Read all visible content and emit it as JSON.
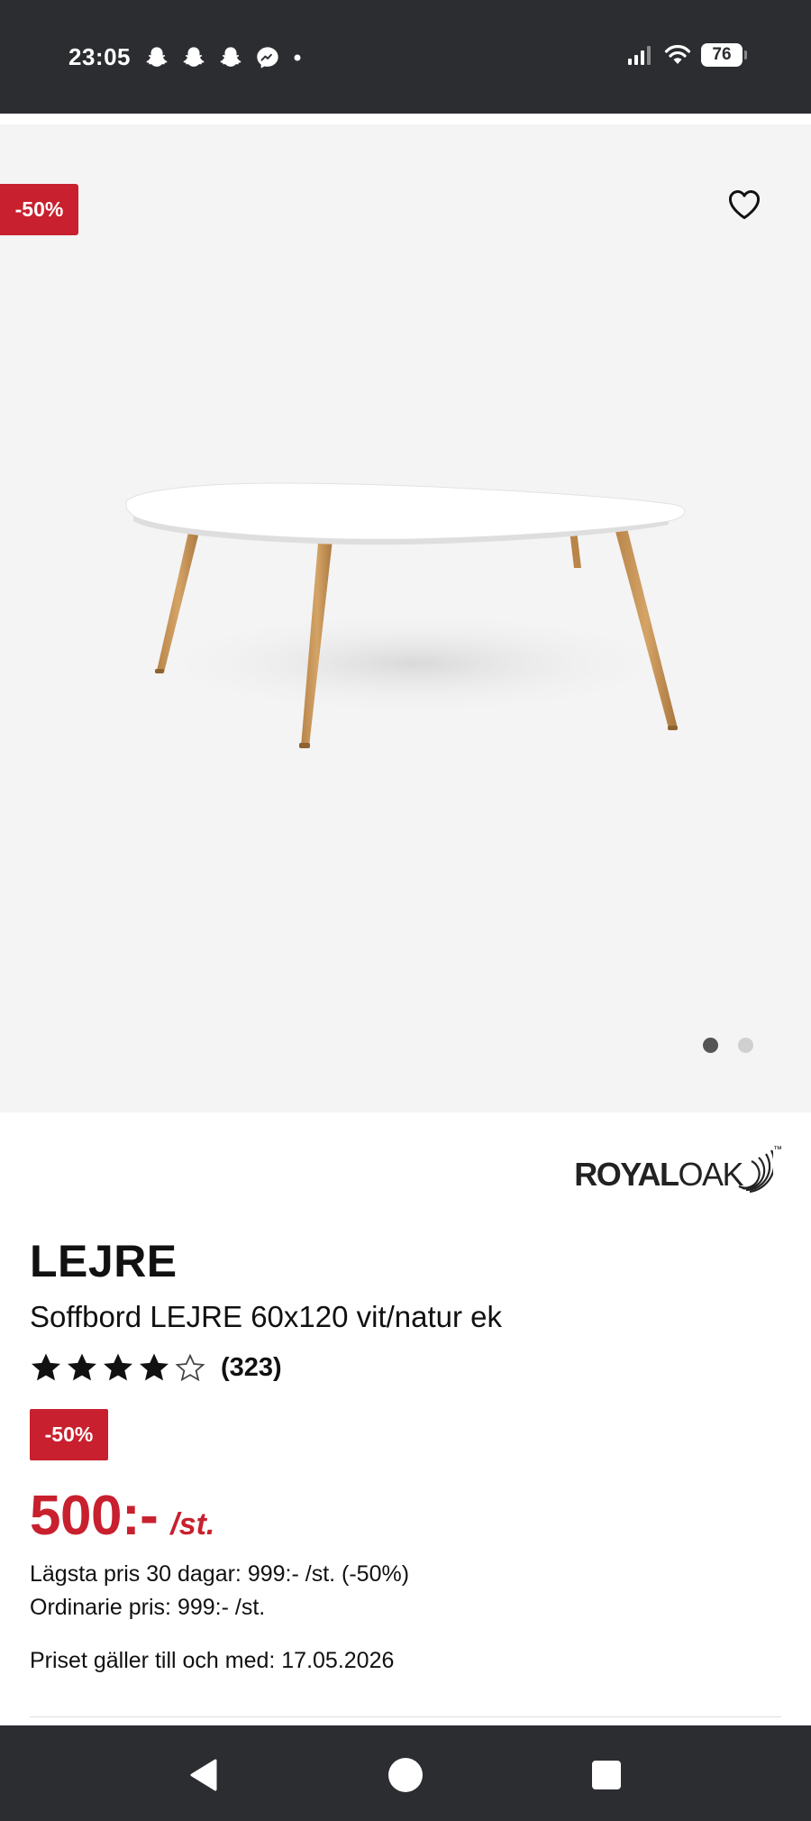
{
  "status_bar": {
    "time": "23:05",
    "notification_icons": [
      "snapchat-icon",
      "snapchat-icon",
      "snapchat-icon",
      "messenger-icon",
      "more-dot-icon"
    ],
    "battery": "76"
  },
  "product_gallery": {
    "discount_badge": "-50%",
    "image_count": 2,
    "active_index": 0
  },
  "brand": {
    "part1": "ROYAL",
    "part2": "OAK",
    "trademark": "™"
  },
  "product": {
    "name": "LEJRE",
    "description": "Soffbord LEJRE 60x120 vit/natur ek",
    "rating": 4,
    "rating_max": 5,
    "review_count": "(323)",
    "discount_badge": "-50%",
    "price": "500:-",
    "price_unit": "/st.",
    "lowest_price_30": "Lägsta pris 30 dagar: 999:- /st. (-50%)",
    "regular_price": "Ordinarie pris: 999:- /st.",
    "valid_until": "Priset gäller till och med: 17.05.2026"
  },
  "colors": {
    "accent_red": "#c8202e",
    "system_bar": "#2b2d31",
    "hero_bg": "#f4f4f4"
  }
}
